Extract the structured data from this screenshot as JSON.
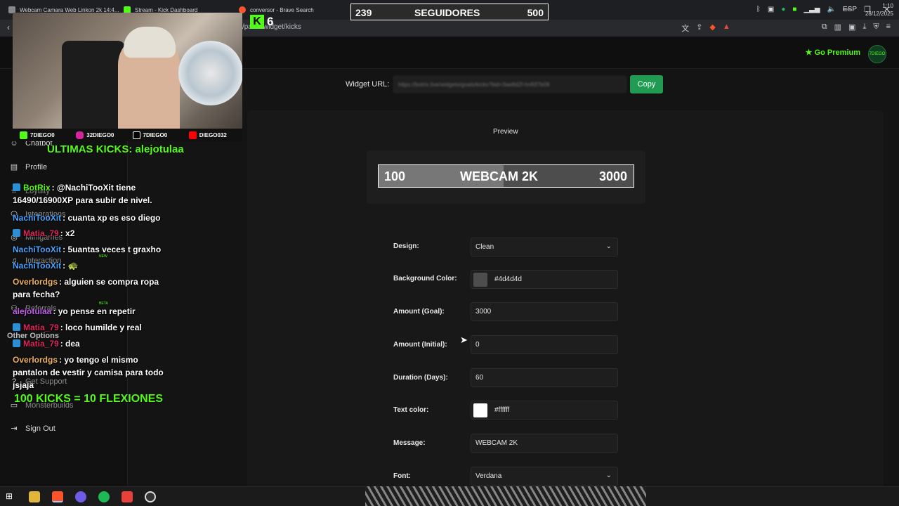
{
  "browser": {
    "tabs": [
      {
        "label": "Webcam Camara Web Linkon 2k 14:4..."
      },
      {
        "label": "Stream - Kick Dashboard"
      },
      {
        "label": "conversor - Brave Search"
      }
    ],
    "url": "/panel/widget/kicks"
  },
  "header": {
    "premium_label": "Go Premium",
    "avatar_text": "7DIEGO"
  },
  "sidebar": {
    "items": [
      {
        "label": "Chatbot"
      },
      {
        "label": "Profile"
      },
      {
        "label": "Loyalty"
      },
      {
        "label": "Integrations"
      },
      {
        "label": "Minigames"
      },
      {
        "label": "Interaction"
      },
      {
        "label": "Referrals"
      },
      {
        "label": "Get Support"
      },
      {
        "label": "Monsterbuilds"
      },
      {
        "label": "Sign Out"
      }
    ],
    "section_other": "Other Options",
    "badge_new": "NEW",
    "badge_beta": "BETA"
  },
  "widget": {
    "url_label": "Widget URL:",
    "url_value": "https://botrix.live/widgets/goals/kicks?bid=3ae8d2f-hnf0f7b09",
    "copy_label": "Copy",
    "preview_label": "Preview",
    "preview_initial": "100",
    "preview_message": "WEBCAM 2K",
    "preview_goal": "3000",
    "preview_progress": 0.49,
    "fields": {
      "design_label": "Design:",
      "design_value": "Clean",
      "bg_label": "Background Color:",
      "bg_value": "#4d4d4d",
      "goal_label": "Amount (Goal):",
      "goal_value": "3000",
      "initial_label": "Amount (Initial):",
      "initial_value": "0",
      "duration_label": "Duration (Days):",
      "duration_value": "60",
      "text_color_label": "Text color:",
      "text_color_value": "#ffffff",
      "message_label": "Message:",
      "message_value": "WEBCAM 2K",
      "font_label": "Font:",
      "font_value": "Verdana"
    }
  },
  "overlay": {
    "followers_current": "239",
    "followers_label": "SEGUIDORES",
    "followers_goal": "500",
    "kick_viewers": "6",
    "socials": [
      {
        "handle": "7DIEGO0",
        "color": "#53fc18"
      },
      {
        "handle": "32DIEGO0",
        "color": "#d6249f"
      },
      {
        "handle": "7DIEGO0",
        "color": "#000000"
      },
      {
        "handle": "DIEGO032",
        "color": "#ff0000"
      }
    ],
    "last_kicks": "ULTIMAS KICKS: alejotulaa",
    "flex_text": "100 KICKS = 10 FLEXIONES",
    "chat": [
      {
        "user": "BotRix",
        "color": "#53fc18",
        "text": ": @NachiTooXit tiene 16490/16900XP para subir de nivel."
      },
      {
        "user": "NachiTooXit",
        "color": "#4aa3ff",
        "text": ": cuanta xp es eso diego"
      },
      {
        "user": "Matia_79",
        "color": "#e0245e",
        "text": ": x2"
      },
      {
        "user": "NachiTooXit",
        "color": "#4aa3ff",
        "text": ": 5uantas veces t graxho"
      },
      {
        "user": "NachiTooXit",
        "color": "#4aa3ff",
        "text": ": 🐢"
      },
      {
        "user": "Overlordgs",
        "color": "#f0b35a",
        "text": ": alguien se compra ropa para fecha?"
      },
      {
        "user": "alejotulaa",
        "color": "#c55cf0",
        "text": ": yo pense en repetir"
      },
      {
        "user": "Matia_79",
        "color": "#e0245e",
        "text": ": loco humilde y real"
      },
      {
        "user": "Matia_79",
        "color": "#e0245e",
        "text": ": dea"
      },
      {
        "user": "Overlordgs",
        "color": "#f0b35a",
        "text": ": yo tengo el mismo pantalon de vestir y camisa para todo jsjaja"
      }
    ]
  },
  "taskbar": {
    "lang": "ESP",
    "time": "1:10",
    "date": "28/12/2025"
  }
}
